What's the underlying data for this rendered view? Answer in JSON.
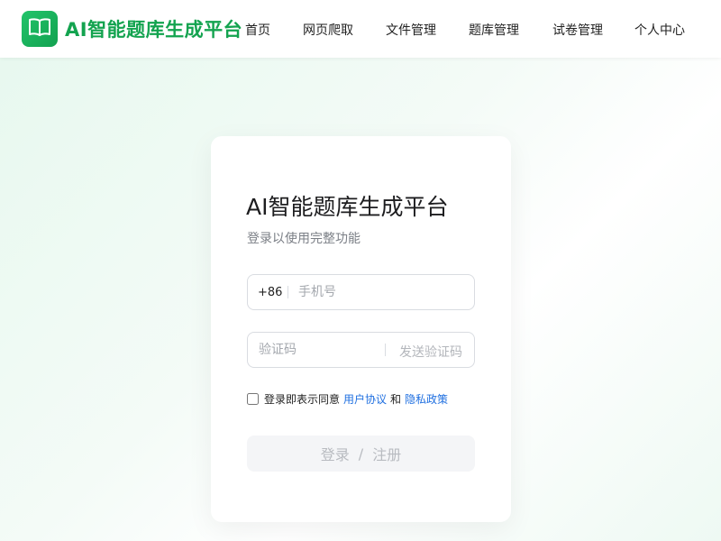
{
  "header": {
    "brand": "AI智能题库生成平台",
    "logo_icon": "book-open-icon",
    "nav": [
      "首页",
      "网页爬取",
      "文件管理",
      "题库管理",
      "试卷管理",
      "个人中心"
    ]
  },
  "login": {
    "title": "AI智能题库生成平台",
    "subtitle": "登录以使用完整功能",
    "phone_prefix": "+86",
    "phone_placeholder": "手机号",
    "code_placeholder": "验证码",
    "send_code_label": "发送验证码",
    "agreement_text": "登录即表示同意",
    "user_agreement": "用户协议",
    "and": "和",
    "privacy_policy": "隐私政策",
    "agreement_checked": false,
    "submit_login": "登录",
    "submit_sep": "/",
    "submit_register": "注册"
  },
  "colors": {
    "brand": "#13a34f",
    "link": "#1f6fe0",
    "disabled_button_bg": "#f4f5f7"
  }
}
